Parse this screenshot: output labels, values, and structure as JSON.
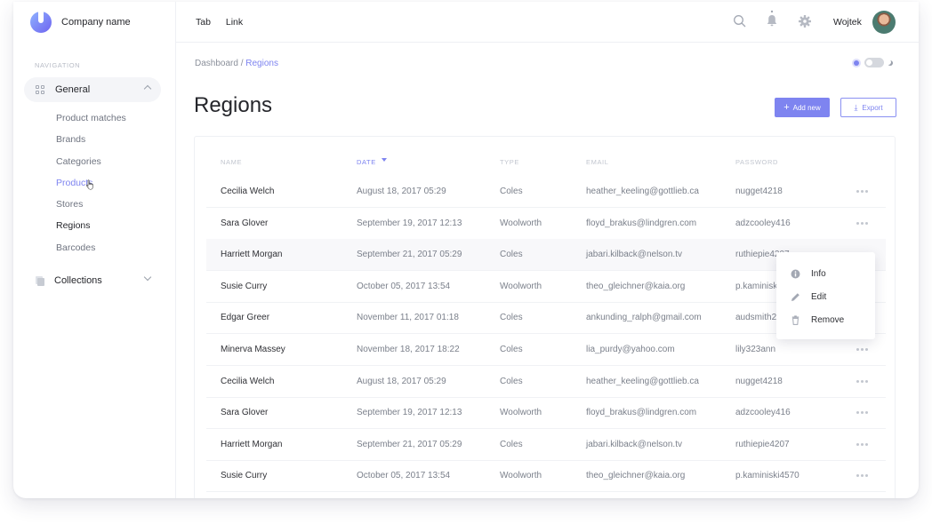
{
  "brand": {
    "name": "Company name"
  },
  "sidebar": {
    "heading": "NAVIGATION",
    "group": {
      "label": "General",
      "icon": "grid-icon"
    },
    "items": [
      {
        "label": "Product matches"
      },
      {
        "label": "Brands"
      },
      {
        "label": "Categories"
      },
      {
        "label": "Products"
      },
      {
        "label": "Stores"
      },
      {
        "label": "Regions"
      },
      {
        "label": "Barcodes"
      }
    ],
    "collections": {
      "label": "Collections",
      "icon": "stack-icon"
    }
  },
  "topbar": {
    "tabs": [
      {
        "label": "Tab"
      },
      {
        "label": "Link"
      }
    ],
    "icons": [
      "search-icon",
      "bell-icon",
      "gear-icon"
    ],
    "user": {
      "name": "Wojtek"
    }
  },
  "breadcrumb": {
    "parent": "Dashboard",
    "separator": "/",
    "current": "Regions"
  },
  "page": {
    "title": "Regions",
    "add_label": "Add new",
    "export_label": "Export"
  },
  "colors": {
    "accent": "#7e84f0",
    "text": "#25262b",
    "muted": "#7b808b"
  },
  "table": {
    "columns": [
      "NAME",
      "DATE",
      "TYPE",
      "EMAIL",
      "PASSWORD"
    ],
    "sorted_column": "DATE",
    "rows": [
      {
        "name": "Cecilia Welch",
        "date": "August 18, 2017 05:29",
        "type": "Coles",
        "email": "heather_keeling@gottlieb.ca",
        "password": "nugget4218"
      },
      {
        "name": "Sara Glover",
        "date": "September 19, 2017 12:13",
        "type": "Woolworth",
        "email": "floyd_brakus@lindgren.com",
        "password": "adzcooley416"
      },
      {
        "name": "Harriett Morgan",
        "date": "September 21, 2017 05:29",
        "type": "Coles",
        "email": "jabari.kilback@nelson.tv",
        "password": "ruthiepie4207"
      },
      {
        "name": "Susie Curry",
        "date": "October 05, 2017 13:54",
        "type": "Woolworth",
        "email": "theo_gleichner@kaia.org",
        "password": "p.kaminiski4570"
      },
      {
        "name": "Edgar Greer",
        "date": "November 11, 2017 01:18",
        "type": "Coles",
        "email": "ankunding_ralph@gmail.com",
        "password": "audsmith2"
      },
      {
        "name": "Minerva Massey",
        "date": "November 18, 2017 18:22",
        "type": "Coles",
        "email": "lia_purdy@yahoo.com",
        "password": "lily323ann"
      },
      {
        "name": "Cecilia Welch",
        "date": "August 18, 2017 05:29",
        "type": "Coles",
        "email": "heather_keeling@gottlieb.ca",
        "password": "nugget4218"
      },
      {
        "name": "Sara Glover",
        "date": "September 19, 2017 12:13",
        "type": "Woolworth",
        "email": "floyd_brakus@lindgren.com",
        "password": "adzcooley416"
      },
      {
        "name": "Harriett Morgan",
        "date": "September 21, 2017 05:29",
        "type": "Coles",
        "email": "jabari.kilback@nelson.tv",
        "password": "ruthiepie4207"
      },
      {
        "name": "Susie Curry",
        "date": "October 05, 2017 13:54",
        "type": "Woolworth",
        "email": "theo_gleichner@kaia.org",
        "password": "p.kaminiski4570"
      }
    ]
  },
  "context_menu": {
    "items": [
      {
        "label": "Info",
        "icon": "info-icon"
      },
      {
        "label": "Edit",
        "icon": "pencil-icon"
      },
      {
        "label": "Remove",
        "icon": "trash-icon"
      }
    ]
  }
}
